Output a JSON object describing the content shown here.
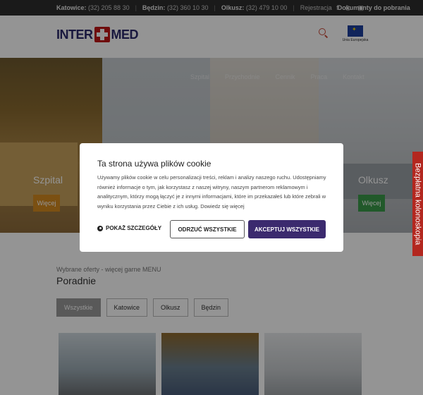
{
  "topbar": {
    "katowice_label": "Katowice:",
    "katowice_phone": "(32) 205 88 30",
    "bedzin_label": "Będzin:",
    "bedzin_phone": "(32) 360 10 30",
    "olkusz_label": "Olkusz:",
    "olkusz_phone": "(32) 479 10 00",
    "register": "Rejestracja",
    "documents": "Dokumenty do pobrania",
    "social": [
      {
        "icon": "facebook-icon",
        "glyph": "f"
      },
      {
        "icon": "instagram-icon",
        "glyph": "◎"
      },
      {
        "icon": "youtube-icon",
        "glyph": "▣"
      }
    ]
  },
  "header": {
    "logo_left": "INTER",
    "logo_right": "MED",
    "eu_label": "Unia Europejska"
  },
  "hero": {
    "nav": [
      "Szpital",
      "Przychodnie",
      "Cennik",
      "Praca",
      "Kontakt"
    ],
    "panels": [
      {
        "title": "Szpital",
        "button": "Więcej",
        "button_color": "#d58b1f"
      },
      {
        "title": "",
        "button": ""
      },
      {
        "title": "",
        "button": ""
      },
      {
        "title": "Olkusz",
        "button": "Więcej",
        "button_color": "#3a9a49"
      }
    ]
  },
  "sidetab": {
    "label": "Bezpłatna kolonoskopia",
    "color": "#b3271f"
  },
  "content": {
    "breadcrumb": "Wybrane oferty - więcej garne MENU",
    "section_title": "Poradnie",
    "tabs": [
      {
        "label": "Wszystkie",
        "active": true
      },
      {
        "label": "Katowice",
        "active": false
      },
      {
        "label": "Olkusz",
        "active": false
      },
      {
        "label": "Będzin",
        "active": false
      }
    ]
  },
  "cookie": {
    "title": "Ta strona używa plików cookie",
    "body": "Używamy plików cookie w celu personalizacji treści, reklam i analizy naszego ruchu. Udostępniamy również informacje o tym, jak korzystasz z naszej witryny, naszym partnerom reklamowym i analitycznym, którzy mogą łączyć je z innymi informacjami, które im przekazałeś lub które zebrali w wyniku korzystania przez Ciebie z ich usług. Dowiedz się więcej",
    "details_label": "POKAŻ SZCZEGÓŁY",
    "reject_label": "ODRZUĆ WSZYSTKIE",
    "accept_label": "AKCEPTUJ WSZYSTKIE",
    "accept_color": "#3b2a6e"
  }
}
